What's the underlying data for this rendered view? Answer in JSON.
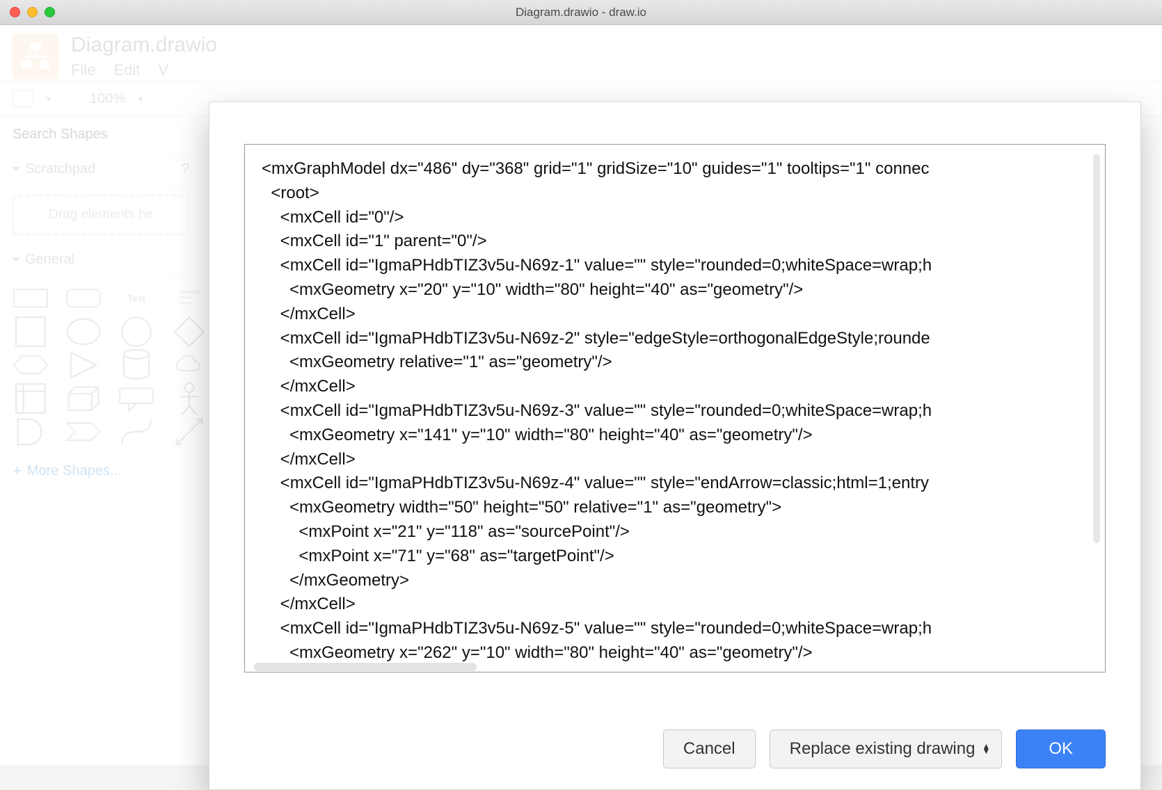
{
  "window": {
    "title": "Diagram.drawio - draw.io"
  },
  "header": {
    "doc_title": "Diagram.drawio",
    "menu": [
      "File",
      "Edit",
      "V"
    ]
  },
  "toolbar": {
    "zoom": "100%"
  },
  "sidebar": {
    "search_placeholder": "Search Shapes",
    "scratchpad_label": "Scratchpad",
    "scratchpad_help": "?",
    "scratchpad_hint": "Drag elements he",
    "general_label": "General",
    "text_label": "Text",
    "heading_label": "Heading",
    "more_shapes": "More Shapes..."
  },
  "modal": {
    "xml": "<mxGraphModel dx=\"486\" dy=\"368\" grid=\"1\" gridSize=\"10\" guides=\"1\" tooltips=\"1\" connec\n  <root>\n    <mxCell id=\"0\"/>\n    <mxCell id=\"1\" parent=\"0\"/>\n    <mxCell id=\"IgmaPHdbTIZ3v5u-N69z-1\" value=\"\" style=\"rounded=0;whiteSpace=wrap;h\n      <mxGeometry x=\"20\" y=\"10\" width=\"80\" height=\"40\" as=\"geometry\"/>\n    </mxCell>\n    <mxCell id=\"IgmaPHdbTIZ3v5u-N69z-2\" style=\"edgeStyle=orthogonalEdgeStyle;rounde\n      <mxGeometry relative=\"1\" as=\"geometry\"/>\n    </mxCell>\n    <mxCell id=\"IgmaPHdbTIZ3v5u-N69z-3\" value=\"\" style=\"rounded=0;whiteSpace=wrap;h\n      <mxGeometry x=\"141\" y=\"10\" width=\"80\" height=\"40\" as=\"geometry\"/>\n    </mxCell>\n    <mxCell id=\"IgmaPHdbTIZ3v5u-N69z-4\" value=\"\" style=\"endArrow=classic;html=1;entry\n      <mxGeometry width=\"50\" height=\"50\" relative=\"1\" as=\"geometry\">\n        <mxPoint x=\"21\" y=\"118\" as=\"sourcePoint\"/>\n        <mxPoint x=\"71\" y=\"68\" as=\"targetPoint\"/>\n      </mxGeometry>\n    </mxCell>\n    <mxCell id=\"IgmaPHdbTIZ3v5u-N69z-5\" value=\"\" style=\"rounded=0;whiteSpace=wrap;h\n      <mxGeometry x=\"262\" y=\"10\" width=\"80\" height=\"40\" as=\"geometry\"/>",
    "cancel_label": "Cancel",
    "replace_label": "Replace existing drawing",
    "ok_label": "OK"
  }
}
